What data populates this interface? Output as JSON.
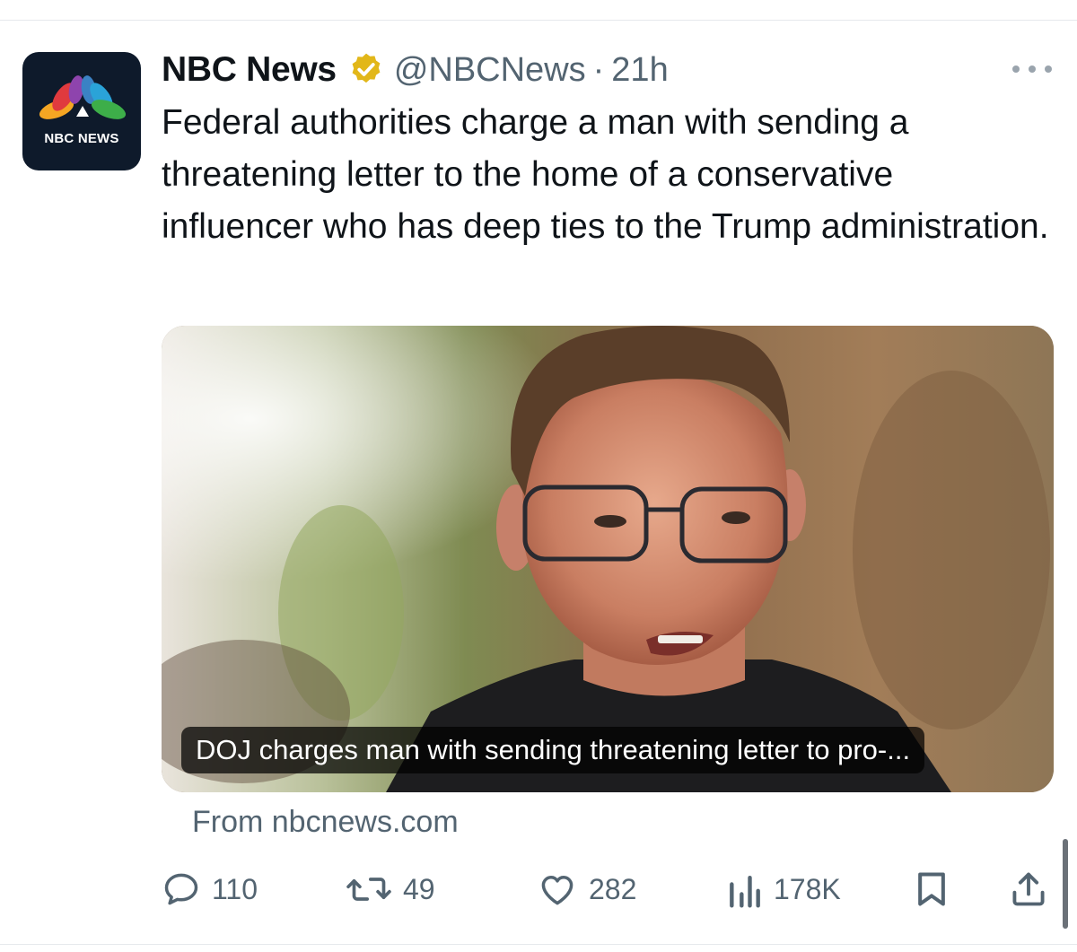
{
  "tweet": {
    "author_name": "NBC News",
    "handle": "@NBCNews",
    "separator": "·",
    "time": "21h",
    "avatar_text": "NBC NEWS",
    "text": "Federal authorities charge a man with sending a threatening letter to the home of a conservative influencer who has deep ties to the Trump administration."
  },
  "card": {
    "caption": "DOJ charges man with sending threatening letter to pro-...",
    "source": "From nbcnews.com"
  },
  "actions": {
    "replies": "110",
    "reposts": "49",
    "likes": "282",
    "views": "178K"
  },
  "icons": {
    "verified": "verified-badge-icon",
    "more": "more-icon",
    "reply": "reply-icon",
    "repost": "repost-icon",
    "like": "heart-icon",
    "views": "views-icon",
    "bookmark": "bookmark-icon",
    "share": "share-icon"
  },
  "colors": {
    "text": "#0f1419",
    "secondary": "#536471",
    "verified_gold": "#e2b719",
    "avatar_bg": "#0e1a2b"
  }
}
